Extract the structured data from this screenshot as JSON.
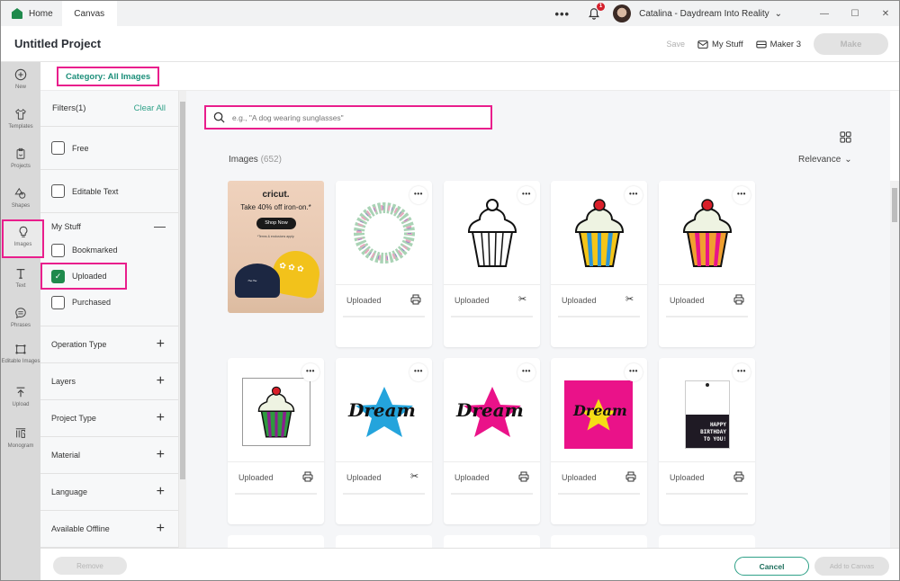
{
  "titlebar": {
    "tabs": [
      {
        "label": "Home",
        "icon": "home-icon"
      },
      {
        "label": "Canvas"
      }
    ],
    "more_label": "•••",
    "notifications_count": "1",
    "user_name": "Catalina - Daydream Into Reality",
    "window_controls": {
      "minimize": "—",
      "maximize": "☐",
      "close": "✕"
    }
  },
  "header": {
    "project_title": "Untitled Project",
    "save_label": "Save",
    "my_stuff_label": "My Stuff",
    "machine_label": "Maker 3",
    "make_label": "Make"
  },
  "rail": {
    "items": [
      {
        "label": "New",
        "icon": "plus-circle-icon"
      },
      {
        "label": "Templates",
        "icon": "shirt-icon"
      },
      {
        "label": "Projects",
        "icon": "clipboard-icon"
      },
      {
        "label": "Shapes",
        "icon": "shapes-icon"
      },
      {
        "label": "Images",
        "icon": "bulb-icon",
        "active": true
      },
      {
        "label": "Text",
        "icon": "text-icon"
      },
      {
        "label": "Phrases",
        "icon": "speech-bubble-icon"
      },
      {
        "label": "Editable Images",
        "icon": "editable-image-icon"
      },
      {
        "label": "Upload",
        "icon": "upload-icon"
      },
      {
        "label": "Monogram",
        "icon": "monogram-icon"
      }
    ]
  },
  "category": {
    "label": "Category: All Images"
  },
  "filters": {
    "title": "Filters(1)",
    "clear_all": "Clear All",
    "top_checkboxes": [
      {
        "label": "Free",
        "checked": false
      },
      {
        "label": "Editable Text",
        "checked": false
      }
    ],
    "my_stuff": {
      "title": "My Stuff",
      "collapse_icon": "—",
      "items": [
        {
          "label": "Bookmarked",
          "checked": false
        },
        {
          "label": "Uploaded",
          "checked": true
        },
        {
          "label": "Purchased",
          "checked": false
        }
      ]
    },
    "accordions": [
      "Operation Type",
      "Layers",
      "Project Type",
      "Material",
      "Language",
      "Available Offline"
    ],
    "expand_icon": "+"
  },
  "search": {
    "placeholder": "e.g., \"A dog wearing sunglasses\"",
    "value": ""
  },
  "results": {
    "title": "Images",
    "count": "(652)",
    "sort_label": "Relevance",
    "ad": {
      "brand": "cricut.",
      "promo": "Take 40% off iron-on.*",
      "button": "Shop Now",
      "terms": "*Terms & exclusions apply."
    },
    "cards": [
      {
        "label": "Uploaded",
        "op": "print",
        "image": "floral-wreath"
      },
      {
        "label": "Uploaded",
        "op": "cut",
        "image": "cupcake-outline"
      },
      {
        "label": "Uploaded",
        "op": "cut",
        "image": "cupcake-blue-yellow"
      },
      {
        "label": "Uploaded",
        "op": "print",
        "image": "cupcake-pink-orange"
      },
      {
        "label": "Uploaded",
        "op": "print",
        "image": "cupcake-purple-green"
      },
      {
        "label": "Uploaded",
        "op": "cut",
        "image": "dream-blue-star"
      },
      {
        "label": "Uploaded",
        "op": "print",
        "image": "dream-pink-star"
      },
      {
        "label": "Uploaded",
        "op": "print",
        "image": "dream-pink-square"
      },
      {
        "label": "Uploaded",
        "op": "print",
        "image": "happy-birthday-tag"
      }
    ],
    "birthday_text": [
      "HAPPY",
      "BIRTHDAY",
      "TO YOU!"
    ],
    "dream_text": "Dream",
    "more_icon": "•••"
  },
  "footer": {
    "remove_label": "Remove",
    "cancel_label": "Cancel",
    "add_label": "Add to Canvas"
  },
  "colors": {
    "accent_teal": "#2fa188",
    "brand_green": "#1f8a4c",
    "highlight_pink": "#e91e8c",
    "badge_red": "#d4202c"
  }
}
